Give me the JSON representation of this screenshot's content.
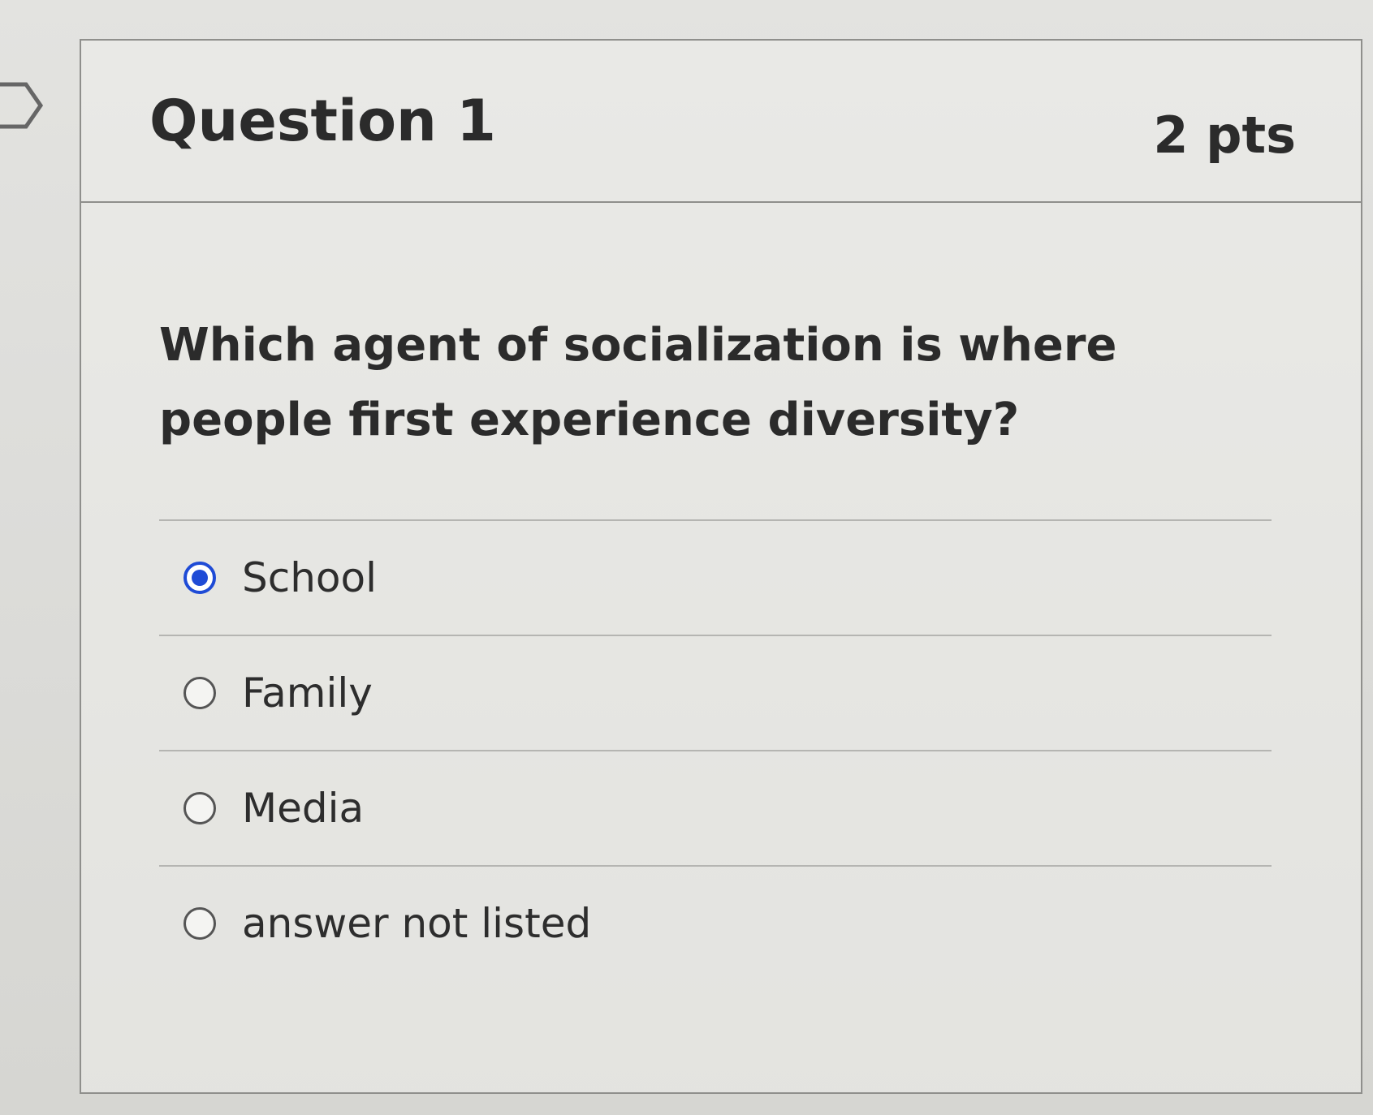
{
  "question": {
    "title": "Question 1",
    "points": "2 pts",
    "text": "Which agent of socialization is where people first experience diversity?"
  },
  "answers": [
    {
      "label": "School",
      "selected": true
    },
    {
      "label": "Family",
      "selected": false
    },
    {
      "label": "Media",
      "selected": false
    },
    {
      "label": "answer not listed",
      "selected": false
    }
  ],
  "colors": {
    "selected_radio": "#1f4bd6",
    "border": "#8f8f8c"
  }
}
